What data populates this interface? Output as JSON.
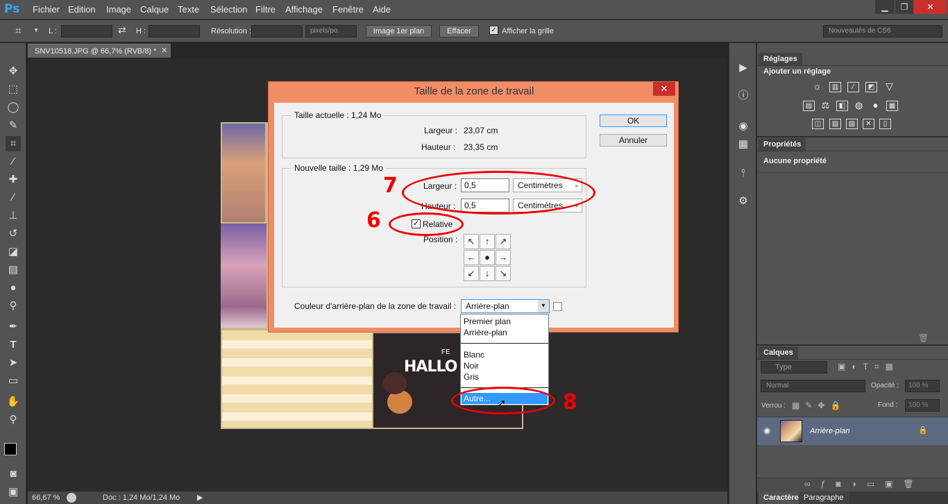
{
  "app": {
    "logo": "Ps",
    "menu": [
      "Fichier",
      "Edition",
      "Image",
      "Calque",
      "Texte",
      "Sélection",
      "Filtre",
      "Affichage",
      "Fenêtre",
      "Aide"
    ]
  },
  "options": {
    "l_label": "L :",
    "h_label": "H :",
    "resolution_label": "Résolution :",
    "units_value": "pixels/po.",
    "front_image_button": "Image 1er plan",
    "clear_button": "Effacer",
    "show_grid_label": "Afficher la grille",
    "workspace_value": "Nouveautés de CS6"
  },
  "document": {
    "tab_title": "SNV10518.JPG @ 66,7% (RVB/8) *",
    "zoom": "66,67 %",
    "doc_info": "Doc : 1,24 Mo/1,24 Mo",
    "photo_text": "HALLO",
    "photo_text2": "FE"
  },
  "dialog": {
    "title": "Taille de la zone de travail",
    "current_size_label": "Taille actuelle : 1,24 Mo",
    "current_width_label": "Largeur :",
    "current_width_value": "23,07 cm",
    "current_height_label": "Hauteur :",
    "current_height_value": "23,35 cm",
    "new_size_label": "Nouvelle taille : 1,29 Mo",
    "width_label": "Largeur :",
    "width_value": "0,5",
    "width_unit": "Centimètres",
    "height_label": "Hauteur :",
    "height_value": "0,5",
    "height_unit": "Centimètres",
    "relative_label": "Relative",
    "relative_checked": true,
    "position_label": "Position :",
    "bg_color_label": "Couleur d'arrière-plan de la zone de travail :",
    "bg_color_value": "Arrière-plan",
    "ok_button": "OK",
    "cancel_button": "Annuler",
    "dropdown_options": [
      "Premier plan",
      "Arrière-plan",
      "Blanc",
      "Noir",
      "Gris",
      "Autre..."
    ],
    "selected_option": "Autre..."
  },
  "annotations": [
    "7",
    "6",
    "8"
  ],
  "panels": {
    "adjustments_tab": "Réglages",
    "add_adjustment": "Ajouter un réglage",
    "properties_tab": "Propriétés",
    "no_properties": "Aucune propriété",
    "layers_tab": "Calques",
    "type_filter": "Type",
    "blend_mode": "Normal",
    "opacity_label": "Opacité :",
    "opacity_value": "100 %",
    "lock_label": "Verrou :",
    "fill_label": "Fond :",
    "fill_value": "100 %",
    "layer_name": "Arrière-plan",
    "character_tab": "Caractère",
    "paragraph_tab": "Paragraphe"
  },
  "colors": {
    "accent": "#31a8ff",
    "dialog_frame": "#f08c66",
    "annotation_red": "#e00000",
    "selection_blue": "#3399ff"
  }
}
